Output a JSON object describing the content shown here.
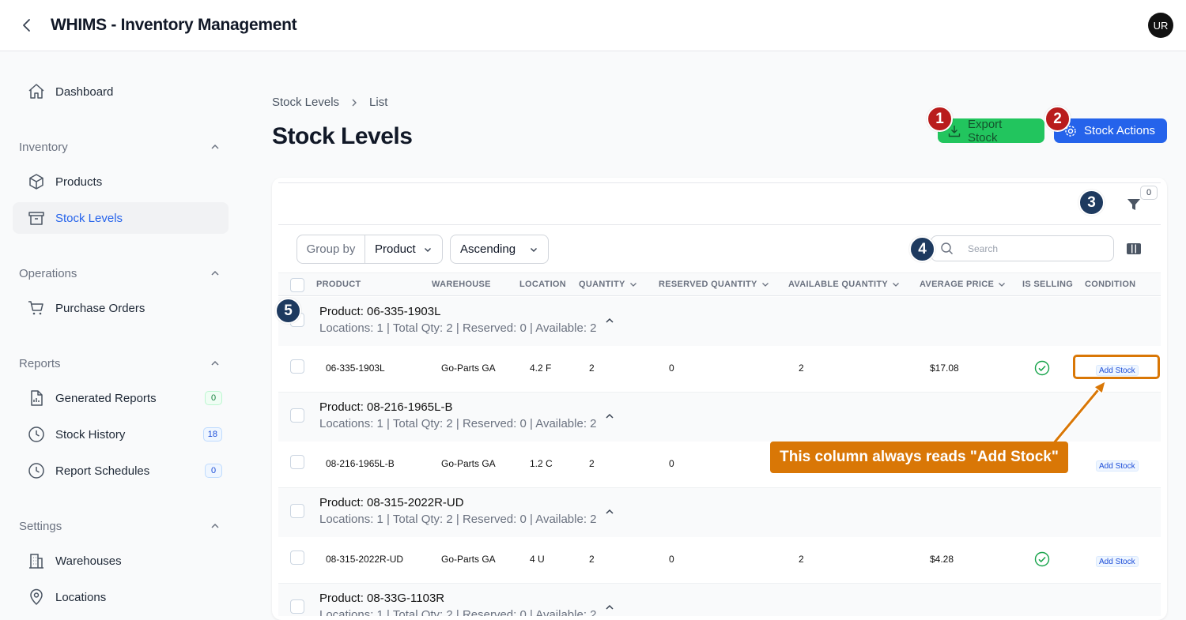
{
  "app": {
    "title": "WHIMS - Inventory Management",
    "avatar_initials": "UR"
  },
  "sidebar": {
    "dashboard": "Dashboard",
    "groups": {
      "inventory": {
        "label": "Inventory",
        "items": [
          "Products",
          "Stock Levels"
        ]
      },
      "operations": {
        "label": "Operations",
        "items": [
          "Purchase Orders"
        ]
      },
      "reports": {
        "label": "Reports",
        "items": [
          "Generated Reports",
          "Stock History",
          "Report Schedules"
        ],
        "badges": [
          "0",
          "18",
          "0"
        ]
      },
      "settings": {
        "label": "Settings",
        "items": [
          "Warehouses",
          "Locations"
        ]
      }
    }
  },
  "breadcrumb": {
    "root": "Stock Levels",
    "current": "List"
  },
  "page_title": "Stock Levels",
  "actions": {
    "export": "Export Stock",
    "stock_actions": "Stock Actions"
  },
  "filters": {
    "count": "0"
  },
  "toolbar": {
    "group_by_label": "Group by",
    "group_by_value": "Product",
    "sort_value": "Ascending",
    "search_placeholder": "Search"
  },
  "columns": [
    "PRODUCT",
    "WAREHOUSE",
    "LOCATION",
    "QUANTITY",
    "RESERVED QUANTITY",
    "AVAILABLE QUANTITY",
    "AVERAGE PRICE",
    "IS SELLING",
    "CONDITION"
  ],
  "groups": [
    {
      "title": "Product: 06-335-1903L",
      "summary": "Locations: 1 | Total Qty: 2 | Reserved: 0 | Available: 2",
      "row": {
        "product": "06-335-1903L",
        "warehouse": "Go-Parts GA",
        "location": "4.2 F",
        "quantity": "2",
        "reserved": "0",
        "available": "2",
        "price": "$17.08",
        "condition": "Add Stock"
      }
    },
    {
      "title": "Product: 08-216-1965L-B",
      "summary": "Locations: 1 | Total Qty: 2 | Reserved: 0 | Available: 2",
      "row": {
        "product": "08-216-1965L-B",
        "warehouse": "Go-Parts GA",
        "location": "1.2 C",
        "quantity": "2",
        "reserved": "0",
        "available": "",
        "price": "",
        "condition": "Add Stock"
      }
    },
    {
      "title": "Product: 08-315-2022R-UD",
      "summary": "Locations: 1 | Total Qty: 2 | Reserved: 0 | Available: 2",
      "row": {
        "product": "08-315-2022R-UD",
        "warehouse": "Go-Parts GA",
        "location": "4 U",
        "quantity": "2",
        "reserved": "0",
        "available": "2",
        "price": "$4.28",
        "condition": "Add Stock"
      }
    },
    {
      "title": "Product: 08-33G-1103R",
      "summary": "Locations: 1 | Total Qty: 2 | Reserved: 0 | Available: 2"
    }
  ],
  "annotations": {
    "markers": [
      "1",
      "2",
      "3",
      "4",
      "5"
    ],
    "callout": "This column always reads \"Add Stock\""
  },
  "colors": {
    "primary": "#2563eb",
    "export_green": "#22c55e",
    "marker_red": "#b91c1c",
    "marker_navy": "#1e3a5f",
    "callout_orange": "#d97706"
  }
}
